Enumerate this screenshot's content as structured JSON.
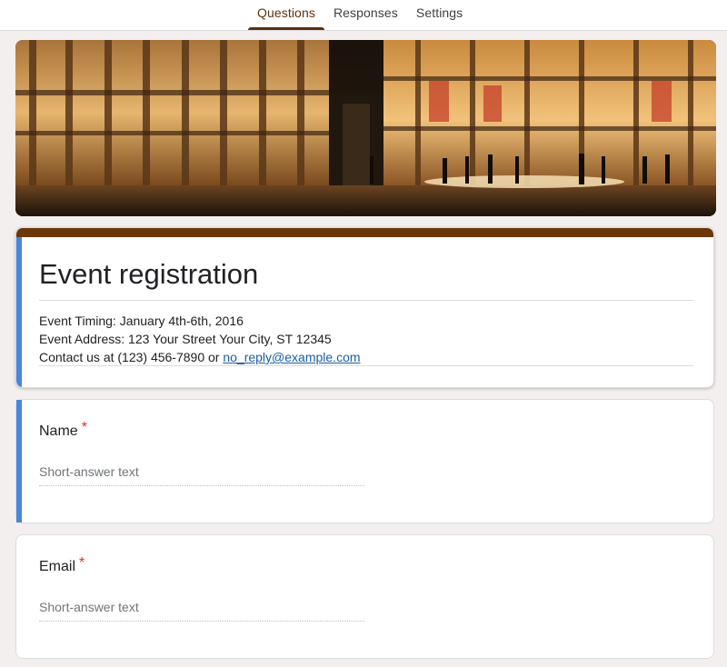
{
  "tabs": [
    {
      "label": "Questions",
      "active": true
    },
    {
      "label": "Responses",
      "active": false
    },
    {
      "label": "Settings",
      "active": false
    }
  ],
  "banner": {
    "image": "theater-plaza-night"
  },
  "form": {
    "title": "Event registration",
    "description": {
      "line1": "Event Timing: January 4th-6th, 2016",
      "line2": "Event Address: 123 Your Street Your City, ST 12345",
      "line3_prefix": "Contact us at (123) 456-7890 or ",
      "email_link": "no_reply@example.com"
    }
  },
  "questions": [
    {
      "label": "Name",
      "required_mark": "*",
      "placeholder": "Short-answer text"
    },
    {
      "label": "Email",
      "required_mark": "*",
      "placeholder": "Short-answer text"
    }
  ],
  "colors": {
    "theme": "#6b3709",
    "tab_active": "#5f2f0f",
    "focus_accent": "#4a86d9",
    "required": "#d93025",
    "background": "#f3efee"
  }
}
